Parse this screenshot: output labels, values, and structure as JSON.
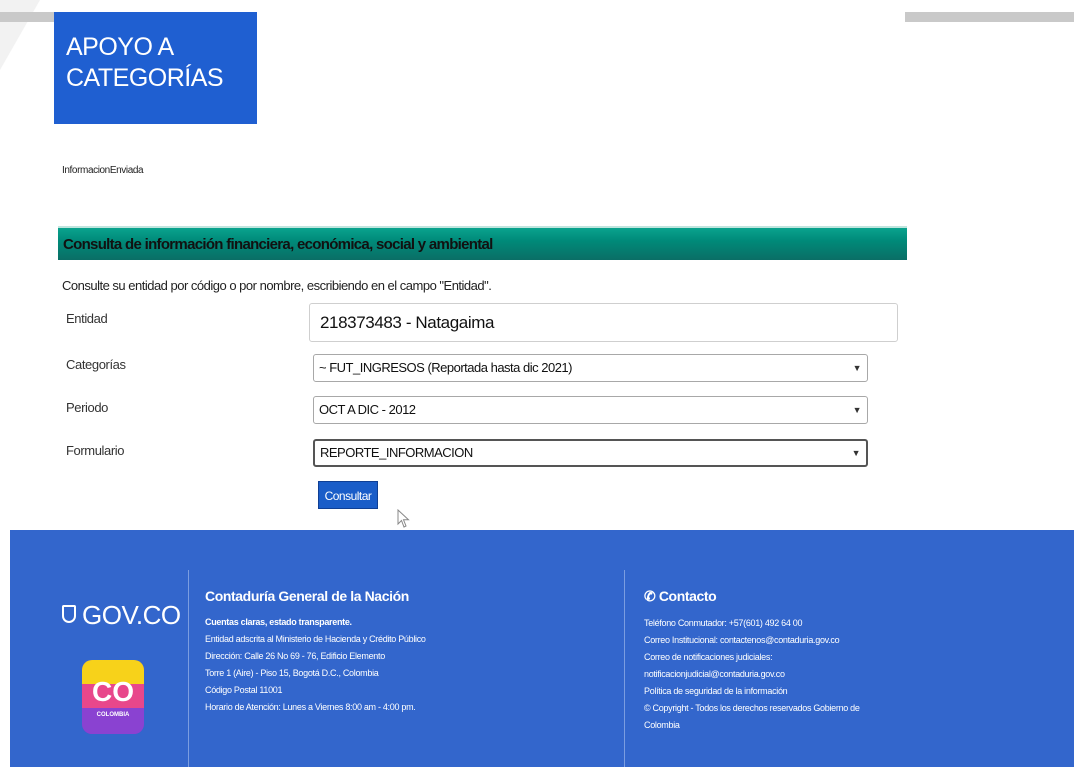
{
  "header": {
    "logo_line1": "APOYO A",
    "logo_line2": "CATEGORÍAS"
  },
  "breadcrumb": "InformacionEnviada",
  "section": {
    "title": "Consulta de información financiera, económica, social y ambiental",
    "intro": "Consulte su entidad por código o por nombre, escribiendo en el campo \"Entidad\"."
  },
  "form": {
    "entidad_label": "Entidad",
    "entidad_value": "218373483 - Natagaima",
    "categorias_label": "Categorías",
    "categorias_value": "~ FUT_INGRESOS (Reportada hasta dic 2021)",
    "periodo_label": "Periodo",
    "periodo_value": "OCT A DIC - 2012",
    "formulario_label": "Formulario",
    "formulario_value": "REPORTE_INFORMACION",
    "consultar_label": "Consultar"
  },
  "footer": {
    "gov_logo": "GOV.CO",
    "co_badge": "CO",
    "co_badge_sub": "COLOMBIA",
    "org_title": "Contaduría General de la Nación",
    "org_lines": [
      "Cuentas claras, estado transparente.",
      "Entidad adscrita al Ministerio de Hacienda y Crédito Público",
      "Dirección: Calle 26 No 69 - 76, Edificio Elemento",
      "Torre 1 (Aire) - Piso 15, Bogotá D.C., Colombia",
      "Código Postal 11001",
      "Horario de Atención: Lunes a Viernes 8:00 am - 4:00 pm."
    ],
    "contact_title": "Contacto",
    "contact_lines": [
      "Teléfono Conmutador: +57(601) 492 64 00",
      "Correo Institucional: contactenos@contaduria.gov.co",
      "Correo de notificaciones judiciales:",
      "notificacionjudicial@contaduria.gov.co",
      "Política de seguridad de la información",
      "© Copyright - Todos los derechos reservados Gobierno de",
      "Colombia"
    ]
  },
  "colors": {
    "primary_blue": "#1f5fd1",
    "footer_blue": "#3366cc",
    "teal_header": "#008a79"
  }
}
